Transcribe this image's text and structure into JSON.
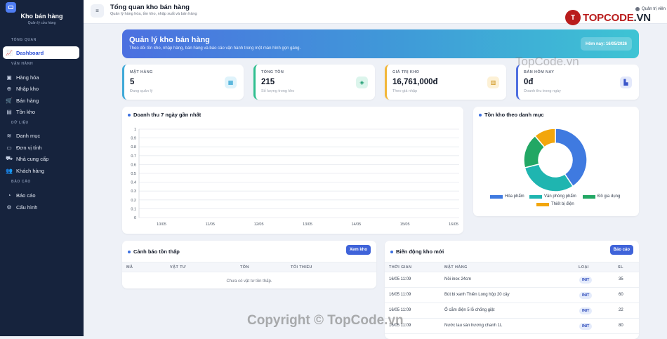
{
  "sidebar": {
    "brand_title": "Kho bán hàng",
    "brand_subtitle": "Quản lý cửa hàng",
    "sections": [
      "Tổng quan",
      "Vận hành",
      "Dữ liệu",
      "Báo cáo"
    ],
    "items": [
      {
        "label": "Dashboard",
        "icon": "chart-line-icon",
        "glyph": "📈"
      },
      {
        "label": "Hàng hóa",
        "icon": "box-icon",
        "glyph": "▣"
      },
      {
        "label": "Nhập kho",
        "icon": "arrow-down-circle-icon",
        "glyph": "⊕"
      },
      {
        "label": "Bán hàng",
        "icon": "cart-icon",
        "glyph": "🛒"
      },
      {
        "label": "Tồn kho",
        "icon": "warehouse-icon",
        "glyph": "▤"
      },
      {
        "label": "Danh mục",
        "icon": "layers-icon",
        "glyph": "≋"
      },
      {
        "label": "Đơn vị tính",
        "icon": "ruler-icon",
        "glyph": "▭"
      },
      {
        "label": "Nhà cung cấp",
        "icon": "truck-icon",
        "glyph": "⛟"
      },
      {
        "label": "Khách hàng",
        "icon": "users-icon",
        "glyph": "👥"
      },
      {
        "label": "Báo cáo",
        "icon": "pie-chart-icon",
        "glyph": "◔"
      },
      {
        "label": "Cấu hình",
        "icon": "gear-icon",
        "glyph": "⚙"
      }
    ]
  },
  "topbar": {
    "menu_glyph": "≡",
    "title": "Tổng quan kho bán hàng",
    "subtitle": "Quản lý hàng hóa, tồn kho, nhập xuất và bán hàng",
    "user_label": "Quản trị viên"
  },
  "logo": {
    "mark": "T",
    "text_main": "TOPCODE",
    "text_suffix": ".VN"
  },
  "hero": {
    "title": "Quản lý kho bán hàng",
    "subtitle": "Theo dõi tồn kho, nhập hàng, bán hàng và báo cáo vận hành trong một màn hình gọn gàng.",
    "date_label": "Hôm nay: 16/05/2026"
  },
  "stats": [
    {
      "label": "Mặt hàng",
      "value": "5",
      "note": "Đang quản lý",
      "color": "#3fa9d8",
      "icon_bg": "#dff3fb",
      "icon_color": "#1f9ccf",
      "glyph": "▦"
    },
    {
      "label": "Tổng tồn",
      "value": "215",
      "note": "Số lượng trong kho",
      "color": "#2fbf8f",
      "icon_bg": "#dcf5ec",
      "icon_color": "#189a6d",
      "glyph": "◈"
    },
    {
      "label": "Giá trị kho",
      "value": "16,761,000đ",
      "note": "Theo giá nhập",
      "color": "#f2b73a",
      "icon_bg": "#fdf1d6",
      "icon_color": "#c98b0b",
      "glyph": "▥"
    },
    {
      "label": "Bán hôm nay",
      "value": "0đ",
      "note": "Doanh thu trong ngày",
      "color": "#4f6fe0",
      "icon_bg": "#e4e9fb",
      "icon_color": "#3a55c9",
      "glyph": "▙"
    }
  ],
  "revenue_card": {
    "title": "Doanh thu 7 ngày gần nhất"
  },
  "category_card": {
    "title": "Tồn kho theo danh mục"
  },
  "low_stock": {
    "title": "Cảnh báo tồn thấp",
    "button": "Xem kho",
    "columns": [
      "Mã",
      "Vật tư",
      "Tồn",
      "Tối thiểu"
    ],
    "empty": "Chưa có vật tư tồn thấp."
  },
  "movements": {
    "title": "Biến động kho mới",
    "button": "Báo cáo",
    "columns": [
      "Thời gian",
      "Mặt hàng",
      "Loại",
      "SL"
    ],
    "rows": [
      {
        "time": "16/05 11:09",
        "item": "Nồi inox 24cm",
        "type": "INIT",
        "qty": "35"
      },
      {
        "time": "16/05 11:09",
        "item": "Bút bi xanh Thiên Long hộp 20 cây",
        "type": "INIT",
        "qty": "60"
      },
      {
        "time": "16/05 11:09",
        "item": "Ổ cắm điện 5 lỗ chống giật",
        "type": "INIT",
        "qty": "22"
      },
      {
        "time": "16/05 11:09",
        "item": "Nước lau sàn hương chanh 1L",
        "type": "INIT",
        "qty": "80"
      }
    ]
  },
  "watermark": {
    "text": "Copyright © TopCode.vn",
    "text2": "TopCode.vn"
  },
  "chart_data": [
    {
      "type": "line",
      "categories": [
        "10/05",
        "11/05",
        "12/05",
        "13/05",
        "14/05",
        "15/05",
        "16/05"
      ],
      "series": [
        {
          "values": [
            0,
            0,
            0,
            0,
            0,
            0,
            0
          ]
        }
      ],
      "yticks": [
        "0",
        "0.1",
        "0.2",
        "0.3",
        "0.4",
        "0.5",
        "0.6",
        "0.7",
        "0.8",
        "0.9",
        "1"
      ],
      "ylim": [
        0,
        1
      ],
      "grid": true,
      "title": "Doanh thu 7 ngày gần nhất"
    },
    {
      "type": "pie",
      "donut": true,
      "categories": [
        "Hóa phẩm",
        "Văn phòng phẩm",
        "Đồ gia dụng",
        "Thiết bị điện"
      ],
      "values": [
        80,
        60,
        35,
        22
      ],
      "colors": [
        "#3f7ae0",
        "#1fb5b0",
        "#22a764",
        "#f2a60c"
      ],
      "legend": "bottom",
      "title": "Tồn kho theo danh mục"
    }
  ]
}
